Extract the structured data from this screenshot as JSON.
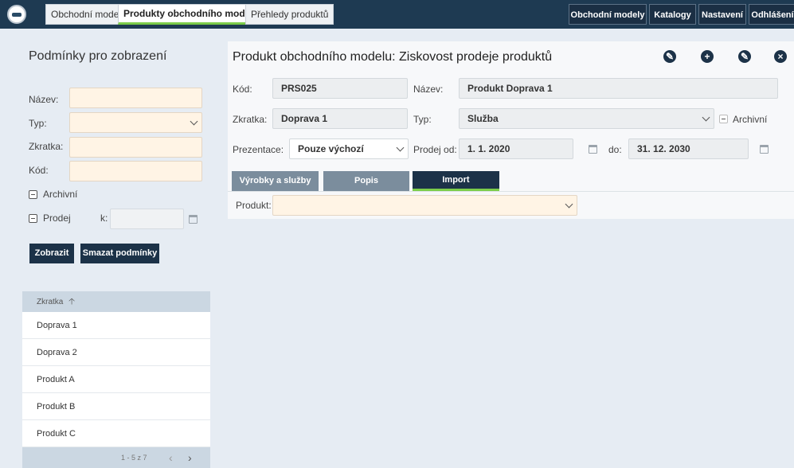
{
  "topnav": {
    "tabs": [
      {
        "label": "Obchodní model"
      },
      {
        "label": "Produkty obchodního modelu"
      },
      {
        "label": "Přehledy produktů"
      }
    ],
    "right_buttons": [
      {
        "label": "Obchodní modely"
      },
      {
        "label": "Katalogy"
      },
      {
        "label": "Nastavení"
      },
      {
        "label": "Odhlášení"
      }
    ]
  },
  "filter": {
    "title": "Podmínky pro zobrazení",
    "name_label": "Název:",
    "type_label": "Typ:",
    "abbr_label": "Zkratka:",
    "code_label": "Kód:",
    "archive_label": "Archivní",
    "sale_label": "Prodej",
    "sale_k_label": "k:",
    "show_button": "Zobrazit",
    "clear_button": "Smazat podmínky"
  },
  "list": {
    "column": "Zkratka",
    "rows": [
      "Doprava 1",
      "Doprava 2",
      "Produkt A",
      "Produkt B",
      "Produkt C"
    ],
    "pagination": "1 - 5 z 7"
  },
  "detail": {
    "title": "Produkt obchodního modelu: Ziskovost prodeje produktů",
    "code_label": "Kód:",
    "code_value": "PRS025",
    "name_label": "Název:",
    "name_value": "Produkt Doprava 1",
    "abbr_label": "Zkratka:",
    "abbr_value": "Doprava 1",
    "type_label": "Typ:",
    "type_value": "Služba",
    "archive_label": "Archivní",
    "presentation_label": "Prezentace:",
    "presentation_value": "Pouze výchozí",
    "sale_from_label": "Prodej od:",
    "sale_from_value": "1. 1. 2020",
    "sale_to_label": "do:",
    "sale_to_value": "31. 12. 2030",
    "tabs": [
      {
        "label": "Výrobky a služby"
      },
      {
        "label": "Popis"
      },
      {
        "label": "Import"
      }
    ],
    "product_label": "Produkt:"
  },
  "colors": {
    "topbar": "#1e3a52",
    "button_dark": "#1c3248",
    "accent_green": "#7ccd4a",
    "input_highlight": "#fff4e5"
  }
}
